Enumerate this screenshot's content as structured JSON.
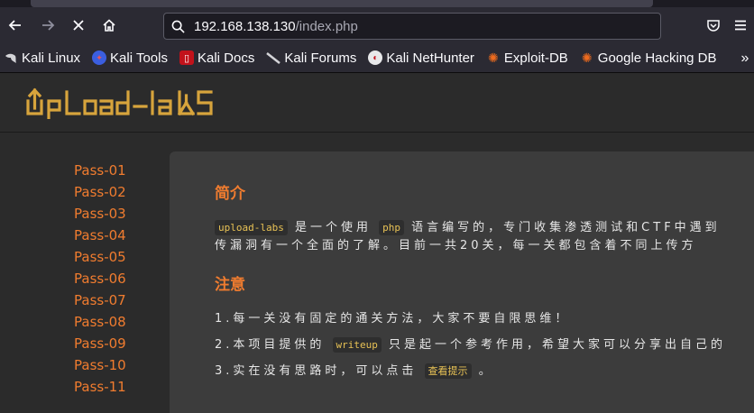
{
  "browser": {
    "url_host": "192.168.138.130",
    "url_path": "/index.php",
    "bookmarks": [
      "Kali Linux",
      "Kali Tools",
      "Kali Docs",
      "Kali Forums",
      "Kali NetHunter",
      "Exploit-DB",
      "Google Hacking DB"
    ],
    "icons": {
      "back": "arrow-left-icon",
      "forward": "arrow-right-icon",
      "stop": "close-icon",
      "home": "home-icon",
      "pocket": "pocket-icon",
      "menu": "hamburger-menu-icon",
      "more": "chevron-double-right-icon"
    }
  },
  "site": {
    "logo": "Upload-labs",
    "accent": "#f07c2f",
    "sidebar": [
      "Pass-01",
      "Pass-02",
      "Pass-03",
      "Pass-04",
      "Pass-05",
      "Pass-06",
      "Pass-07",
      "Pass-08",
      "Pass-09",
      "Pass-10",
      "Pass-11"
    ]
  },
  "content": {
    "intro_title": "简介",
    "intro_code1": "upload-labs",
    "intro_text1": "是一个使用",
    "intro_code2": "php",
    "intro_text2": "语言编写的，专门收集渗透测试和CTF中遇到",
    "intro_line2": "传漏洞有一个全面的了解。目前一共20关，每一关都包含着不同上传方",
    "notice_title": "注意",
    "notice_1": "1.每一关没有固定的通关方法，大家不要自限思维！",
    "notice_2a": "2.本项目提供的",
    "notice_2_code": "writeup",
    "notice_2b": "只是起一个参考作用，希望大家可以分享出自己的",
    "notice_3a": "3.实在没有思路时，可以点击",
    "notice_3_code": "查看提示",
    "notice_3b": "。"
  }
}
